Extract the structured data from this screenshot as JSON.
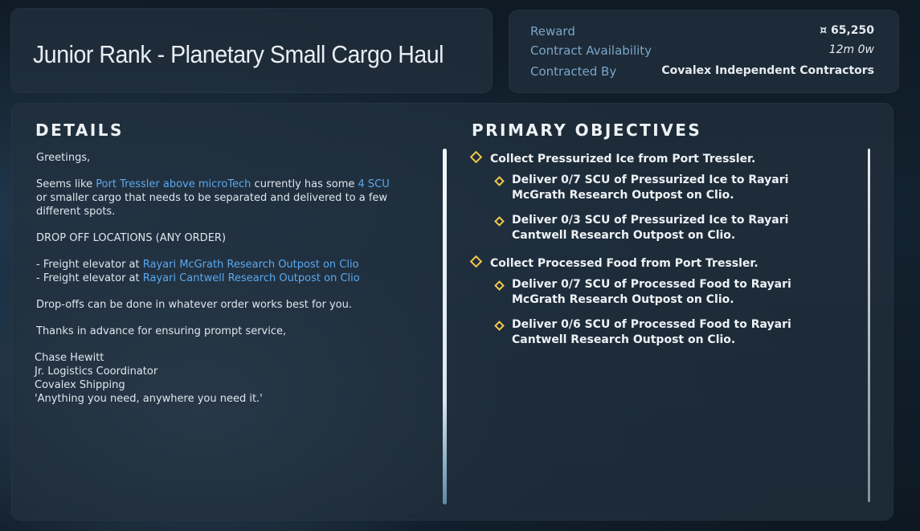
{
  "title": "Junior Rank - Planetary Small Cargo Haul",
  "info": {
    "reward_label": "Reward",
    "reward_value": "¤ 65,250",
    "availability_label": "Contract Availability",
    "availability_value": "12m 0w",
    "contracted_by_label": "Contracted By",
    "contracted_by_value": "Covalex Independent Contractors"
  },
  "details": {
    "heading": "DETAILS",
    "greeting": "Greetings,",
    "p1_a": "Seems like ",
    "p1_link1": "Port Tressler above microTech",
    "p1_b": " currently has some ",
    "p1_link2": "4 SCU",
    "p1_c": " or smaller cargo that needs to be separated and delivered to a few different spots.",
    "dropoff_heading": "DROP OFF LOCATIONS (ANY ORDER)",
    "dropoff_prefix": "- Freight elevator at ",
    "dropoff_1": "Rayari McGrath Research Outpost on Clio",
    "dropoff_2": "Rayari Cantwell Research Outpost on Clio",
    "order_note": "Drop-offs can be done in whatever order works best for you.",
    "thanks": "Thanks in advance for ensuring prompt service,",
    "sig_name": "Chase Hewitt",
    "sig_title": "Jr. Logistics Coordinator",
    "sig_company": "Covalex Shipping",
    "sig_motto": "'Anything you need, anywhere you need it.'"
  },
  "objectives": {
    "heading": "PRIMARY OBJECTIVES",
    "groups": [
      {
        "label": "Collect Pressurized Ice from Port Tressler.",
        "items": [
          "Deliver 0/7 SCU of Pressurized Ice to Rayari McGrath Research Outpost on Clio.",
          "Deliver 0/3 SCU of Pressurized Ice to Rayari Cantwell Research Outpost on Clio."
        ]
      },
      {
        "label": "Collect Processed Food from Port Tressler.",
        "items": [
          "Deliver 0/7 SCU of Processed Food to Rayari McGrath Research Outpost on Clio.",
          "Deliver 0/6 SCU of Processed Food to Rayari Cantwell Research Outpost on Clio."
        ]
      }
    ]
  },
  "colors": {
    "link": "#5aa9f0",
    "label": "#7aa6c9",
    "objective_marker": "#f1c84a"
  }
}
